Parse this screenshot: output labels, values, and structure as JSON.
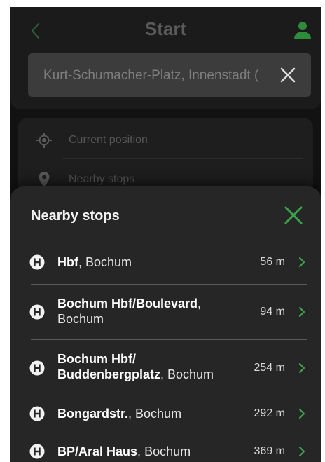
{
  "header": {
    "title": "Start",
    "back_icon": "chevron-left-icon",
    "profile_icon": "person-icon",
    "accent_color": "#2e8b3c"
  },
  "search": {
    "value": "Kurt-Schumacher-Platz, Innenstadt (",
    "clear_icon": "close-icon"
  },
  "options": [
    {
      "label": "Current position",
      "icon": "crosshair-icon"
    },
    {
      "label": "Nearby stops",
      "icon": "map-pin-icon"
    }
  ],
  "sheet": {
    "title": "Nearby stops",
    "close_icon": "close-icon",
    "accent_color": "#3aa24a",
    "stops": [
      {
        "name": "Hbf",
        "city": "Bochum",
        "distance": "56 m"
      },
      {
        "name": "Bochum Hbf/Boulevard",
        "city": "Bochum",
        "distance": "94 m"
      },
      {
        "name": "Bochum Hbf/ Buddenbergplatz",
        "city": "Bochum",
        "distance": "254 m"
      },
      {
        "name": "Bongardstr.",
        "city": "Bochum",
        "distance": "292 m"
      },
      {
        "name": "BP/Aral Haus",
        "city": "Bochum",
        "distance": "369 m"
      }
    ]
  }
}
